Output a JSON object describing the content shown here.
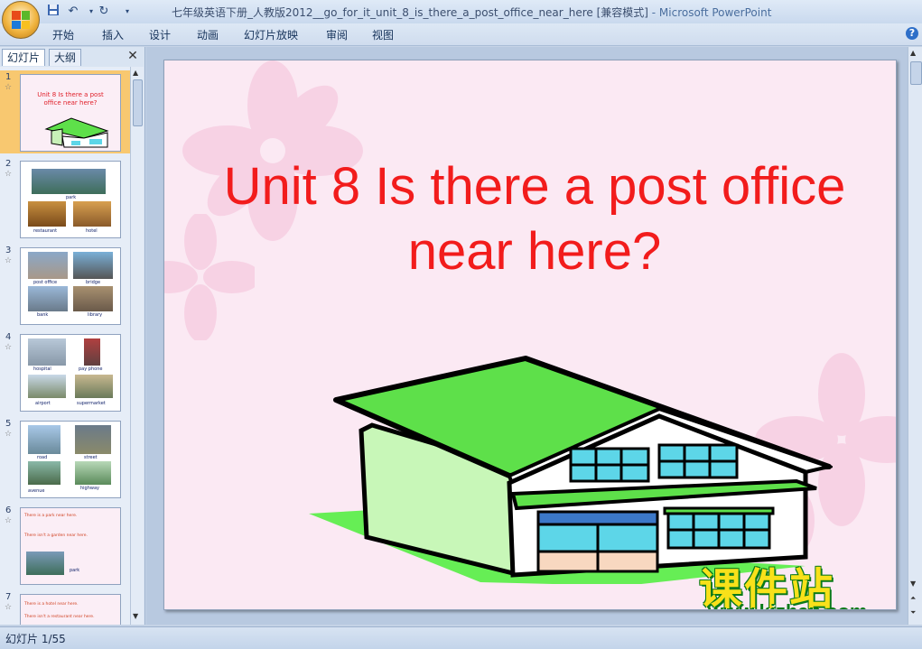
{
  "window": {
    "title": "七年级英语下册_人教版2012__go_for_it_unit_8_is_there_a_post_office_near_here [兼容模式]",
    "app_suffix": " - Microsoft PowerPoint"
  },
  "quick_access": {
    "icons": [
      "save-icon",
      "undo-icon",
      "redo-icon",
      "customize-dropdown-icon"
    ]
  },
  "menu": {
    "items": [
      "开始",
      "插入",
      "设计",
      "动画",
      "幻灯片放映",
      "审阅",
      "视图"
    ]
  },
  "panel": {
    "tabs": [
      "幻灯片",
      "大纲"
    ]
  },
  "thumbnails": [
    {
      "num": "1",
      "title": "Unit  8  Is there a post office near here?"
    },
    {
      "num": "2",
      "captions": [
        "park",
        "restaurant",
        "hotel"
      ]
    },
    {
      "num": "3",
      "captions": [
        "post  office",
        "bridge",
        "bank",
        "library"
      ]
    },
    {
      "num": "4",
      "captions": [
        "hospital",
        "pay  phone",
        "airport",
        "supermarket"
      ]
    },
    {
      "num": "5",
      "captions": [
        "road",
        "street",
        "avenue",
        "highway"
      ]
    },
    {
      "num": "6",
      "lines": [
        "There is a  park  near here.",
        "There isn't a  garden  near here.",
        "park"
      ]
    },
    {
      "num": "7",
      "lines": [
        "There is a  hotel near here.",
        "There isn't a  restaurant  near here."
      ]
    }
  ],
  "slide": {
    "title": "Unit  8  Is there a post office near here?"
  },
  "watermark": {
    "cn": "课件站",
    "url": "www.kjzhan.com"
  },
  "status": {
    "text": "幻灯片 1/55"
  },
  "colors": {
    "title_red": "#f21c1c",
    "roof_green": "#5ee04a",
    "slide_bg": "#fbe9f3",
    "selected_thumb": "#f8c870"
  }
}
